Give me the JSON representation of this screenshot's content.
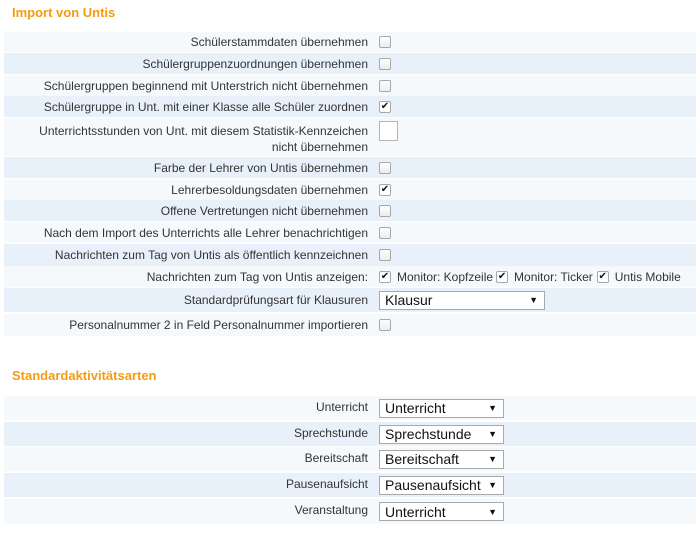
{
  "import": {
    "title": "Import von Untis",
    "rows": [
      {
        "label": "Schülerstammdaten übernehmen",
        "type": "checkbox",
        "checked": false
      },
      {
        "label": "Schülergruppenzuordnungen übernehmen",
        "type": "checkbox",
        "checked": false
      },
      {
        "label": "Schülergruppen beginnend mit Unterstrich nicht übernehmen",
        "type": "checkbox",
        "checked": false
      },
      {
        "label": "Schülergruppe in Unt. mit einer Klasse alle Schüler zuordnen",
        "type": "checkbox",
        "checked": true
      },
      {
        "label": "Unterrichtsstunden von Unt. mit diesem Statistik-Kennzeichen",
        "label2": "nicht übernehmen",
        "type": "text",
        "value": ""
      },
      {
        "label": "Farbe der Lehrer von Untis übernehmen",
        "type": "checkbox",
        "checked": false
      },
      {
        "label": "Lehrerbesoldungsdaten übernehmen",
        "type": "checkbox",
        "checked": true
      },
      {
        "label": "Offene Vertretungen nicht übernehmen",
        "type": "checkbox",
        "checked": false
      },
      {
        "label": "Nach dem Import des Unterrichts alle Lehrer benachrichtigen",
        "type": "checkbox",
        "checked": false
      },
      {
        "label": "Nachrichten zum Tag von Untis als öffentlich kennzeichnen",
        "type": "checkbox",
        "checked": false
      },
      {
        "label": "Nachrichten zum Tag von Untis anzeigen:",
        "type": "multi",
        "options": [
          {
            "label": "Monitor: Kopfzeile",
            "checked": true
          },
          {
            "label": "Monitor: Ticker",
            "checked": true
          },
          {
            "label": "Untis Mobile",
            "checked": true
          }
        ]
      },
      {
        "label": "Standardprüfungsart für Klausuren",
        "type": "select",
        "value": "Klausur"
      },
      {
        "label": "Personalnummer 2 in Feld Personalnummer importieren",
        "type": "checkbox",
        "checked": false
      }
    ]
  },
  "activities": {
    "title": "Standardaktivitätsarten",
    "rows": [
      {
        "label": "Unterricht",
        "value": "Unterricht"
      },
      {
        "label": "Sprechstunde",
        "value": "Sprechstunde"
      },
      {
        "label": "Bereitschaft",
        "value": "Bereitschaft"
      },
      {
        "label": "Pausenaufsicht",
        "value": "Pausenaufsicht"
      },
      {
        "label": "Veranstaltung",
        "value": "Unterricht"
      }
    ]
  },
  "icons": {
    "check": "check-icon",
    "dropdown": "dropdown-arrow-icon"
  }
}
